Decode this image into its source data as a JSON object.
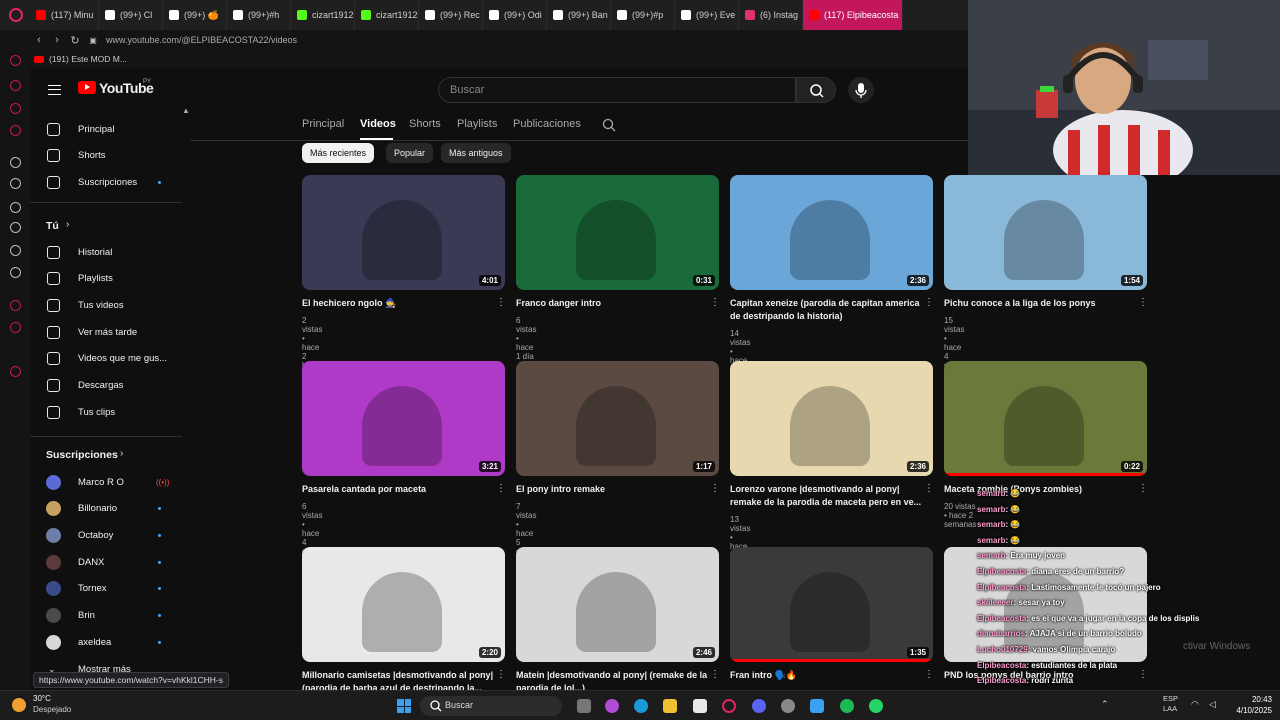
{
  "browser": {
    "tabs": [
      {
        "label": "(117) Minu",
        "color": "#ff0000"
      },
      {
        "label": "(99+) Cl",
        "color": "#ffffff"
      },
      {
        "label": "(99+) 🍊",
        "color": "#ffffff"
      },
      {
        "label": "(99+)#h",
        "color": "#ffffff"
      },
      {
        "label": "cizart1912",
        "color": "#53fc18"
      },
      {
        "label": "cizart1912",
        "color": "#53fc18"
      },
      {
        "label": "(99+) Rec",
        "color": "#ffffff"
      },
      {
        "label": "(99+) Odi",
        "color": "#ffffff"
      },
      {
        "label": "(99+) Ban",
        "color": "#ffffff"
      },
      {
        "label": "(99+)#p",
        "color": "#ffffff"
      },
      {
        "label": "(99+) Eve",
        "color": "#ffffff"
      },
      {
        "label": "(6) Instag",
        "color": "#e1306c"
      },
      {
        "label": "(117) Elpibeacosta",
        "color": "#ff0000"
      }
    ],
    "url": "www.youtube.com/@ELPIBEACOSTA22/videos",
    "bookmark": "(191) Este MOD M..."
  },
  "header": {
    "logo_text": "YouTube",
    "country_code": "PY",
    "search_placeholder": "Buscar"
  },
  "sidebar": {
    "main": [
      {
        "label": "Principal",
        "icon": "home-icon"
      },
      {
        "label": "Shorts",
        "icon": "shorts-icon"
      },
      {
        "label": "Suscripciones",
        "icon": "subscriptions-icon"
      }
    ],
    "you_title": "Tú",
    "you": [
      {
        "label": "Historial",
        "icon": "history-icon"
      },
      {
        "label": "Playlists",
        "icon": "playlists-icon"
      },
      {
        "label": "Tus videos",
        "icon": "your-videos-icon"
      },
      {
        "label": "Ver más tarde",
        "icon": "watch-later-icon"
      },
      {
        "label": "Videos que me gus...",
        "icon": "like-icon"
      },
      {
        "label": "Descargas",
        "icon": "download-icon"
      },
      {
        "label": "Tus clips",
        "icon": "clips-icon"
      }
    ],
    "subs_title": "Suscripciones",
    "subs": [
      {
        "label": "Marco R O",
        "color": "#5b6bd6"
      },
      {
        "label": "Billonario",
        "color": "#c8a062"
      },
      {
        "label": "Octaboy",
        "color": "#6b7fa8"
      },
      {
        "label": "DANX",
        "color": "#5a3a3a"
      },
      {
        "label": "Tornex",
        "color": "#3a4a8a"
      },
      {
        "label": "Brin",
        "color": "#4a4a4a"
      },
      {
        "label": "axeldea",
        "color": "#d8d8d8"
      }
    ],
    "more": "Mostrar más"
  },
  "channel_tabs": [
    "Principal",
    "Videos",
    "Shorts",
    "Playlists",
    "Publicaciones"
  ],
  "active_tab": "Videos",
  "chips": [
    "Más recientes",
    "Popular",
    "Más antiguos"
  ],
  "videos": [
    {
      "title": "El hechicero ngolo 🧙",
      "meta": "2 vistas • hace 2 horas",
      "duration": "4:01",
      "bg": "#3a3a55"
    },
    {
      "title": "Franco danger intro",
      "meta": "6 vistas • hace 1 día",
      "duration": "0:31",
      "bg": "#1a6b3a"
    },
    {
      "title": "Capitan xeneize (parodia de capitan america de destripando la historia)",
      "meta": "14 vistas • hace 2 días",
      "duration": "2:36",
      "bg": "#6aa6d8"
    },
    {
      "title": "Pichu conoce a la liga de los ponys",
      "meta": "15 vistas • hace 4 días",
      "duration": "1:54",
      "bg": "#8ab8d8"
    },
    {
      "title": "Pasarela cantada por maceta",
      "meta": "6 vistas • hace 4 días",
      "duration": "3:21",
      "bg": "#b03ac8"
    },
    {
      "title": "El pony intro remake",
      "meta": "7 vistas • hace 5 días",
      "duration": "1:17",
      "bg": "#5a4a42"
    },
    {
      "title": "Lorenzo varone |desmotivando al pony| remake de la parodia de maceta pero en ve...",
      "meta": "13 vistas • hace 6 días",
      "duration": "2:36",
      "bg": "#e8d8b0"
    },
    {
      "title": "Maceta zombie (Ponys zombies)",
      "meta": "20 vistas • hace 2 semanas",
      "duration": "0:22",
      "bg": "#6a7a3a"
    },
    {
      "title": "Millonario camisetas |desmotivando al pony| (parodia de barba azul de destripando la...",
      "meta": "",
      "duration": "2:20",
      "bg": "#e8e8e8"
    },
    {
      "title": "Matein |desmotivando al pony| (remake de la parodia de lol...)",
      "meta": "",
      "duration": "2:46",
      "bg": "#d8d8d8"
    },
    {
      "title": "Fran intro 🗣️🔥",
      "meta": "",
      "duration": "1:35",
      "bg": "#3a3a3a"
    },
    {
      "title": "PND los ponys del barrio intro",
      "meta": "",
      "duration": "",
      "bg": "#d8d8d8"
    }
  ],
  "chat": [
    {
      "user": "semarb",
      "msg": ": 😂"
    },
    {
      "user": "semarb",
      "msg": ": 😂"
    },
    {
      "user": "semarb",
      "msg": ": 😂"
    },
    {
      "user": "semarb",
      "msg": ": 😂"
    },
    {
      "user": "semarb",
      "msg": ": Era muy joven"
    },
    {
      "user": "Elpibeacosta",
      "msg": ": diana eres de un barrio?"
    },
    {
      "user": "Elpibeacosta",
      "msg": ": Lastimosamente le tocó un pajero"
    },
    {
      "user": "skiileeeer",
      "msg": ": sesar ya toy"
    },
    {
      "user": "Elpibeacosta",
      "msg": ": es el que va a jugar en la copa de los displis"
    },
    {
      "user": "dianabarrios",
      "msg": ": AJAJA si de un barrio boludo"
    },
    {
      "user": "Lucho010729",
      "msg": ": vamos Olimpia carajo"
    },
    {
      "user": "Elpibeacosta",
      "msg": ": estudiantes de la plata"
    },
    {
      "user": "Elpibeacosta",
      "msg": ": rodri zurita"
    },
    {
      "user": "Elpibeacosta",
      "msg": ": mira la portada de la parodia"
    }
  ],
  "status_url": "https://www.youtube.com/watch?v=vhKkl1CHH-s",
  "windows_activate": "ctivar Windows",
  "taskbar": {
    "weather_temp": "30°C",
    "weather_text": "Despejado",
    "search": "Buscar",
    "lang1": "ESP",
    "lang2": "LAA",
    "time": "20:43",
    "date": "4/10/2025"
  }
}
